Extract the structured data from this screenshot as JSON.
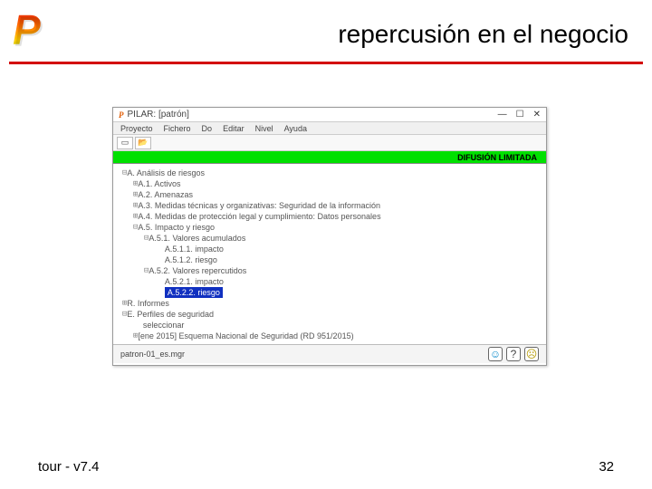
{
  "slide": {
    "title": "repercusión en el negocio",
    "footer_left": "tour - v7.4",
    "footer_right": "32"
  },
  "window": {
    "title": "PILAR: [patrón]",
    "menu": [
      "Proyecto",
      "Fichero",
      "Do",
      "Editar",
      "Nivel",
      "Ayuda"
    ],
    "diffusion": "DIFUSIÓN LIMITADA",
    "status_file": "patron-01_es.mgr"
  },
  "tree": {
    "n0": "A. Análisis de riesgos",
    "n1": "A.1. Activos",
    "n2": "A.2. Amenazas",
    "n3": "A.3. Medidas técnicas y organizativas: Seguridad de la información",
    "n4": "A.4. Medidas de protección legal y cumplimiento: Datos personales",
    "n5": "A.5. Impacto y riesgo",
    "n6": "A.5.1. Valores acumulados",
    "n7": "A.5.1.1. impacto",
    "n8": "A.5.1.2. riesgo",
    "n9": "A.5.2. Valores repercutidos",
    "n10": "A.5.2.1. impacto",
    "n11": "A.5.2.2. riesgo",
    "n12": "R. Informes",
    "n13": "E. Perfiles de seguridad",
    "n14": "seleccionar",
    "n15": "[ene 2015] Esquema Nacional de Seguridad (RD 951/2015)"
  }
}
